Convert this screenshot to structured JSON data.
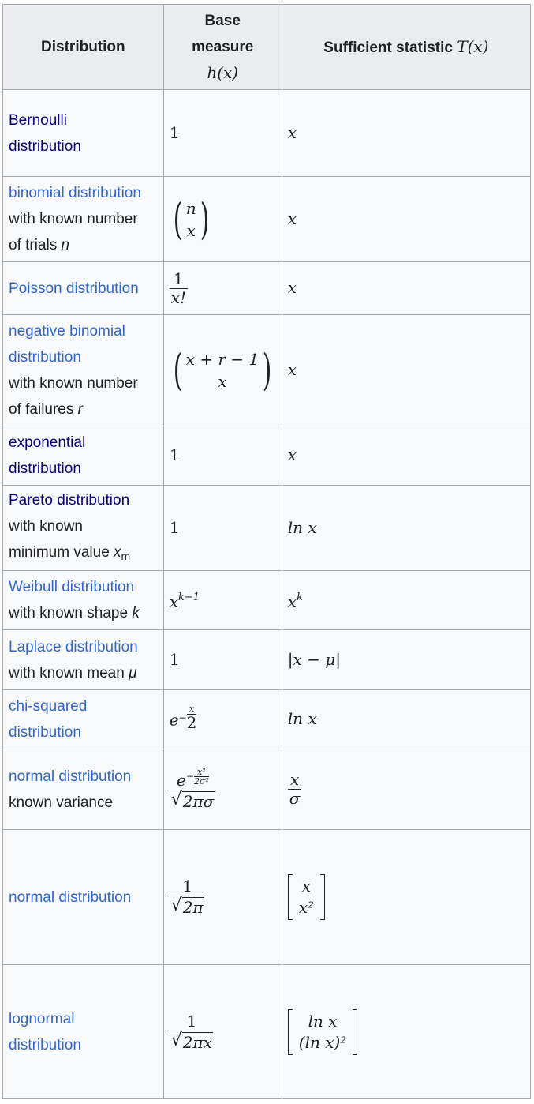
{
  "header": {
    "col1": "Distribution",
    "col2_line1": "Base",
    "col2_line2": "measure",
    "col2_math": "h(x)",
    "col3": "Sufficient statistic",
    "col3_math": "T(x)"
  },
  "rows": [
    {
      "name": "Bernoulli distribution",
      "name_line1": "Bernoulli",
      "name_line2": "distribution",
      "visited": true,
      "base": "1",
      "stat": "x"
    },
    {
      "name": "binomial distribution",
      "qual1": "with known number",
      "qual2": "of trials",
      "qual_var": "n",
      "base_top": "n",
      "base_bottom": "x",
      "stat": "x"
    },
    {
      "name": "Poisson distribution",
      "base_num": "1",
      "base_den": "x!",
      "stat": "x"
    },
    {
      "name_line1": "negative binomial",
      "name_line2": "distribution",
      "qual1": "with known number",
      "qual2": "of failures",
      "qual_var": "r",
      "base_top": "x + r − 1",
      "base_bottom": "x",
      "stat": "x"
    },
    {
      "name_line1": "exponential",
      "name_line2": "distribution",
      "visited": true,
      "base": "1",
      "stat": "x"
    },
    {
      "name": "Pareto distribution",
      "visited": true,
      "qual1": "with known",
      "qual2": "minimum value",
      "qual_var": "x",
      "qual_sub": "m",
      "base": "1",
      "stat": "ln x"
    },
    {
      "name": "Weibull distribution",
      "qual1": "with known shape",
      "qual_var": "k",
      "base_base": "x",
      "base_sup": "k−1",
      "stat_base": "x",
      "stat_sup": "k"
    },
    {
      "name": "Laplace distribution",
      "qual1": "with known mean",
      "qual_var": "μ",
      "base": "1",
      "stat": "|x − μ|"
    },
    {
      "name_line1": "chi-squared",
      "name_line2": "distribution",
      "base_base": "e",
      "base_sup_prefix": "−",
      "base_sup_num": "x",
      "base_sup_den": "2",
      "stat": "ln x"
    },
    {
      "name": "normal distribution",
      "qual1": "known variance",
      "base_e": "e",
      "base_exp_num": "x²",
      "base_exp_den": "2σ²",
      "base_den": "2πσ",
      "stat_num": "x",
      "stat_den": "σ"
    },
    {
      "name": "normal distribution",
      "base_num": "1",
      "base_den": "2π",
      "stat_top": "x",
      "stat_bottom": "x²"
    },
    {
      "name_line1": "lognormal",
      "name_line2": "distribution",
      "base_num": "1",
      "base_den": "2πx",
      "stat_top": "ln x",
      "stat_bottom": "(ln x)²"
    }
  ],
  "colors": {
    "link": "#3366cc",
    "visited": "#0b0080",
    "border": "#a2a9b1",
    "header_bg": "#eaecf0",
    "cell_bg": "#f8f9fa"
  }
}
